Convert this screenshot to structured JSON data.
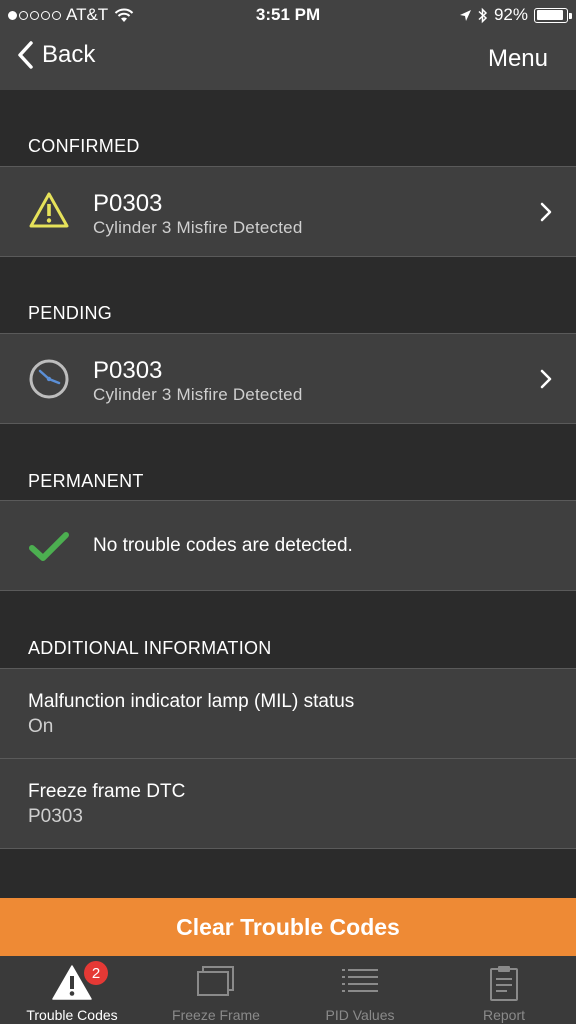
{
  "status_bar": {
    "carrier": "AT&T",
    "time": "3:51 PM",
    "battery": "92%",
    "battery_level": 0.92
  },
  "nav": {
    "back_label": "Back",
    "menu_label": "Menu"
  },
  "sections": {
    "confirmed": {
      "header": "CONFIRMED",
      "item": {
        "code": "P0303",
        "description": "Cylinder 3 Misfire Detected",
        "icon": "warning-triangle-icon"
      }
    },
    "pending": {
      "header": "PENDING",
      "item": {
        "code": "P0303",
        "description": "Cylinder 3 Misfire Detected",
        "icon": "clock-icon"
      }
    },
    "permanent": {
      "header": "PERMANENT",
      "message": "No trouble codes are detected.",
      "icon": "checkmark-icon"
    },
    "additional": {
      "header": "ADDITIONAL INFORMATION",
      "items": [
        {
          "label": "Malfunction indicator lamp (MIL) status",
          "value": "On"
        },
        {
          "label": "Freeze frame DTC",
          "value": "P0303"
        }
      ]
    }
  },
  "clear_button": {
    "label": "Clear Trouble Codes"
  },
  "tabs": [
    {
      "label": "Trouble Codes",
      "icon": "warning-triangle-icon",
      "badge": "2",
      "active": true
    },
    {
      "label": "Freeze Frame",
      "icon": "freeze-frame-icon",
      "active": false
    },
    {
      "label": "PID Values",
      "icon": "list-icon",
      "active": false
    },
    {
      "label": "Report",
      "icon": "clipboard-icon",
      "active": false
    }
  ],
  "colors": {
    "accent": "#ee8a35",
    "background": "#2b2b2b",
    "row_bg": "#3f3f3f",
    "warning": "#e6e25a",
    "check": "#4caf50",
    "badge": "#e53935",
    "inactive_tab": "#8a8a8a"
  }
}
